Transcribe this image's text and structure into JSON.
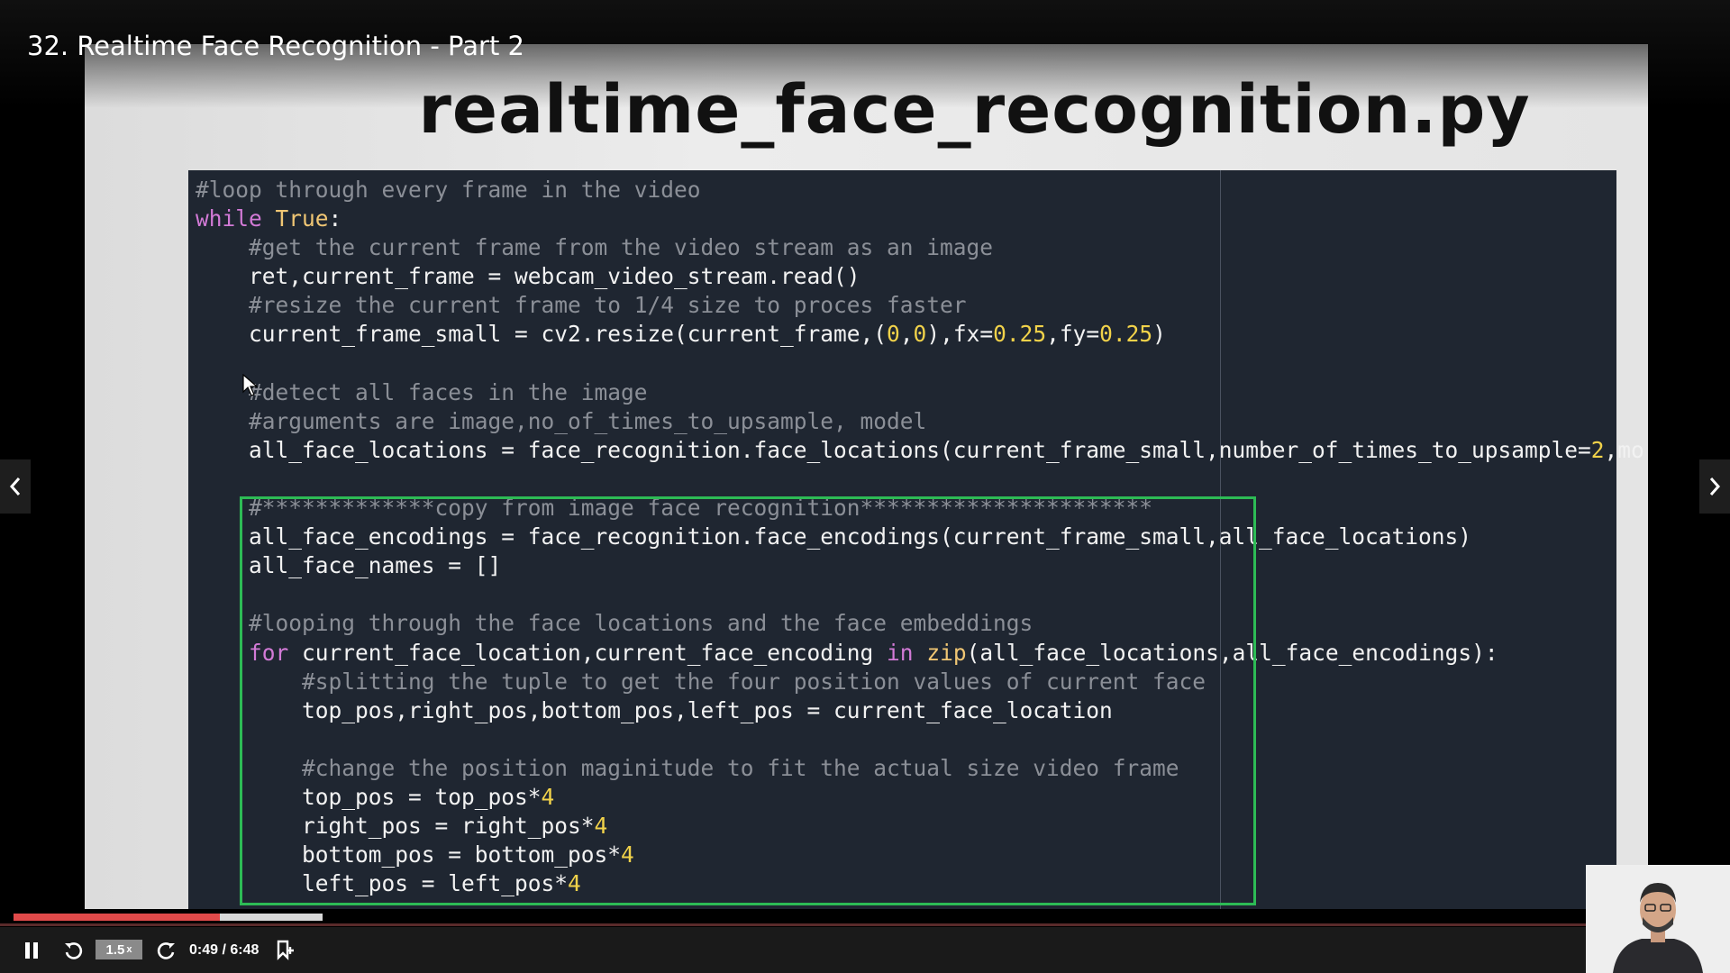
{
  "player": {
    "title": "32. Realtime Face Recognition - Part 2",
    "speed_label": "1.5",
    "speed_suffix": "x",
    "time": "0:49 / 6:48",
    "progress_fraction": 0.12,
    "buffered_fraction": 0.18
  },
  "slide": {
    "heading": "realtime_face_recognition.py",
    "code_lines": [
      [
        {
          "t": "#loop through every frame in the video",
          "c": "cm"
        }
      ],
      [
        {
          "t": "while ",
          "c": "kw"
        },
        {
          "t": "True",
          "c": "cn"
        },
        {
          "t": ":",
          "c": ""
        }
      ],
      [
        {
          "t": "    #get the current frame from the video stream as an image",
          "c": "cm"
        }
      ],
      [
        {
          "t": "    ret,current_frame = webcam_video_stream.read()",
          "c": ""
        }
      ],
      [
        {
          "t": "    #resize the current frame to 1/4 size to proces faster",
          "c": "cm"
        }
      ],
      [
        {
          "t": "    current_frame_small = cv2.resize(current_frame,(",
          "c": ""
        },
        {
          "t": "0",
          "c": "nm"
        },
        {
          "t": ",",
          "c": ""
        },
        {
          "t": "0",
          "c": "nm"
        },
        {
          "t": "),fx=",
          "c": ""
        },
        {
          "t": "0.25",
          "c": "nm"
        },
        {
          "t": ",fy=",
          "c": ""
        },
        {
          "t": "0.25",
          "c": "nm"
        },
        {
          "t": ")",
          "c": ""
        }
      ],
      [
        {
          "t": "",
          "c": ""
        }
      ],
      [
        {
          "t": "    #detect all faces in the image",
          "c": "cm"
        }
      ],
      [
        {
          "t": "    #arguments are image,no_of_times_to_upsample, model",
          "c": "cm"
        }
      ],
      [
        {
          "t": "    all_face_locations = face_recognition.face_locations(current_frame_small,number_of_times_to_upsample=",
          "c": ""
        },
        {
          "t": "2",
          "c": "nm"
        },
        {
          "t": ",mo",
          "c": ""
        }
      ],
      [
        {
          "t": "",
          "c": ""
        }
      ],
      [
        {
          "t": "    #*************copy from image face recognition**********************",
          "c": "cm"
        }
      ],
      [
        {
          "t": "    all_face_encodings = face_recognition.face_encodings(current_frame_small,all_face_locations)",
          "c": ""
        }
      ],
      [
        {
          "t": "    all_face_names = []",
          "c": ""
        }
      ],
      [
        {
          "t": "",
          "c": ""
        }
      ],
      [
        {
          "t": "    #looping through the face locations and the face embeddings",
          "c": "cm"
        }
      ],
      [
        {
          "t": "    ",
          "c": ""
        },
        {
          "t": "for",
          "c": "kw"
        },
        {
          "t": " current_face_location,current_face_encoding ",
          "c": ""
        },
        {
          "t": "in",
          "c": "kw"
        },
        {
          "t": " ",
          "c": ""
        },
        {
          "t": "zip",
          "c": "cn"
        },
        {
          "t": "(all_face_locations,all_face_encodings):",
          "c": ""
        }
      ],
      [
        {
          "t": "        #splitting the tuple to get the four position values of current face",
          "c": "cm"
        }
      ],
      [
        {
          "t": "        top_pos,right_pos,bottom_pos,left_pos = current_face_location",
          "c": ""
        }
      ],
      [
        {
          "t": "",
          "c": ""
        }
      ],
      [
        {
          "t": "        #change the position maginitude to fit the actual size video frame",
          "c": "cm"
        }
      ],
      [
        {
          "t": "        top_pos = top_pos*",
          "c": ""
        },
        {
          "t": "4",
          "c": "nm"
        }
      ],
      [
        {
          "t": "        right_pos = right_pos*",
          "c": ""
        },
        {
          "t": "4",
          "c": "nm"
        }
      ],
      [
        {
          "t": "        bottom_pos = bottom_pos*",
          "c": ""
        },
        {
          "t": "4",
          "c": "nm"
        }
      ],
      [
        {
          "t": "        left_pos = left_pos*",
          "c": ""
        },
        {
          "t": "4",
          "c": "nm"
        }
      ]
    ]
  },
  "colors": {
    "accent_progress": "#e04a4a",
    "highlight_box": "#2dbb55",
    "code_background": "#1f2631"
  },
  "icons": {
    "pause": "pause-icon",
    "rewind": "rewind-icon",
    "forward": "forward-icon",
    "bookmark": "bookmark-icon",
    "prev": "chevron-left-icon",
    "next": "chevron-right-icon",
    "volume": "volume-icon",
    "settings": "gear-icon",
    "expand": "expand-icon"
  }
}
